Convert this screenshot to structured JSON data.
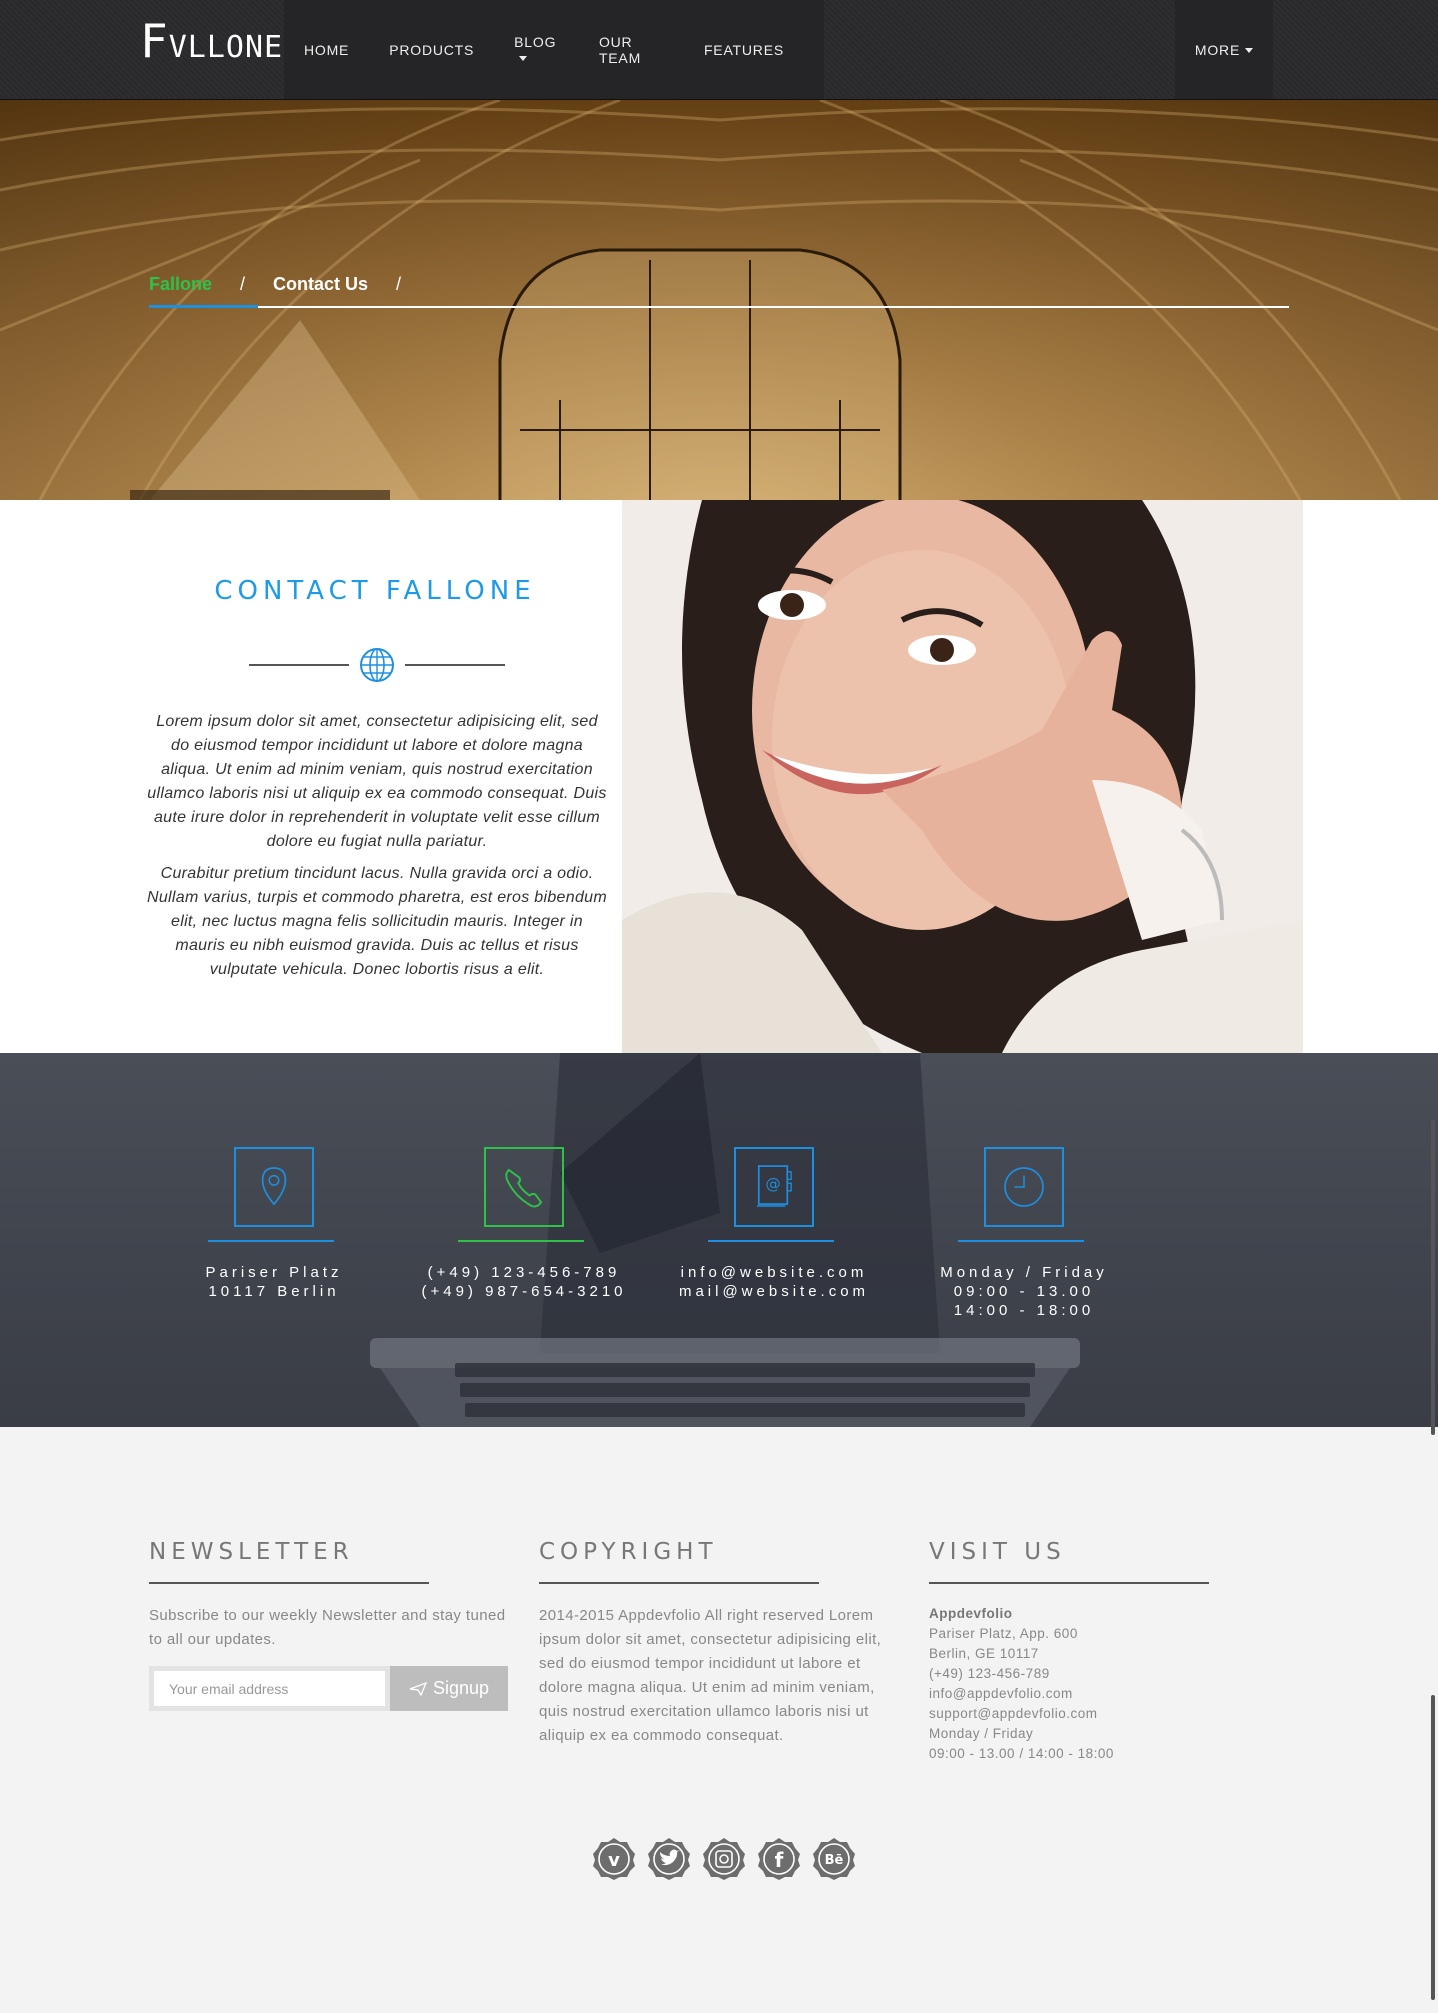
{
  "nav": {
    "logo": "FVLLONE",
    "items": [
      "HOME",
      "PRODUCTS",
      "BLOG",
      "OUR TEAM",
      "FEATURES"
    ],
    "more": "MORE"
  },
  "breadcrumb": {
    "home": "Fallone",
    "current": "Contact Us",
    "separator": "/"
  },
  "contact": {
    "title": "CONTACT FALLONE",
    "paragraph1": "Lorem ipsum dolor sit amet, consectetur adipisicing elit, sed do eiusmod tempor incididunt ut labore et dolore magna aliqua. Ut enim ad minim veniam, quis nostrud exercitation ullamco laboris nisi ut aliquip ex ea commodo consequat. Duis aute irure dolor in reprehenderit in voluptate velit esse cillum dolore eu fugiat nulla pariatur.",
    "paragraph2": "Curabitur pretium tincidunt lacus. Nulla gravida orci a odio. Nullam varius, turpis et commodo pharetra, est eros bibendum elit, nec luctus magna felis sollicitudin mauris. Integer in mauris eu nibh euismod gravida. Duis ac tellus et risus vulputate vehicula. Donec lobortis risus a elit."
  },
  "info": [
    {
      "icon": "map-pin-icon",
      "line1": "Pariser Platz",
      "line2": "10117 Berlin",
      "line3": ""
    },
    {
      "icon": "phone-icon",
      "line1": "(+49) 123-456-789",
      "line2": "(+49) 987-654-3210",
      "line3": ""
    },
    {
      "icon": "address-book-icon",
      "line1": "info@website.com",
      "line2": "mail@website.com",
      "line3": ""
    },
    {
      "icon": "clock-icon",
      "line1": "Monday / Friday",
      "line2": "09:00 - 13.00",
      "line3": "14:00 - 18:00"
    }
  ],
  "footer": {
    "newsletter": {
      "title": "NEWSLETTER",
      "text": "Subscribe to our weekly Newsletter and stay tuned to all our updates.",
      "placeholder": "Your email address",
      "button": "Signup"
    },
    "copyright": {
      "title": "COPYRIGHT",
      "text": "2014-2015 Appdevfolio All right reserved Lorem ipsum dolor sit amet, consectetur adipisicing elit, sed do eiusmod tempor incididunt ut labore et dolore magna aliqua. Ut enim ad minim veniam, quis nostrud exercitation ullamco laboris nisi ut aliquip ex ea commodo consequat."
    },
    "visit": {
      "title": "VISIT US",
      "company": "Appdevfolio",
      "lines": [
        "Pariser Platz, App. 600",
        "Berlin, GE 10117",
        "(+49) 123-456-789",
        "info@appdevfolio.com",
        "support@appdevfolio.com",
        "Monday / Friday",
        "09:00 - 13.00 / 14:00 - 18:00"
      ]
    },
    "socials": [
      "vimeo-icon",
      "twitter-icon",
      "instagram-icon",
      "facebook-icon",
      "behance-icon"
    ],
    "social_glyphs": [
      "v",
      "t",
      "◎",
      "f",
      "Bē"
    ]
  },
  "colors": {
    "accent_blue": "#1e90e0",
    "accent_green": "#2ec24a",
    "nav_bg": "#2a2a2c",
    "info_bg": "#444851",
    "footer_bg": "#f3f3f3"
  }
}
